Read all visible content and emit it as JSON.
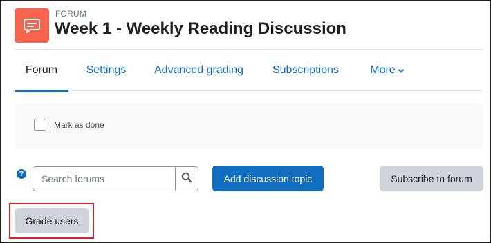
{
  "header": {
    "kicker": "FORUM",
    "title": "Week 1 - Weekly Reading Discussion",
    "icon": "forum-chat-icon",
    "icon_color": "#f7634d"
  },
  "tabs": [
    {
      "label": "Forum",
      "active": true
    },
    {
      "label": "Settings",
      "active": false
    },
    {
      "label": "Advanced grading",
      "active": false
    },
    {
      "label": "Subscriptions",
      "active": false
    },
    {
      "label": "More",
      "active": false
    }
  ],
  "completion": {
    "checkbox_label": "Mark as done",
    "checked": false
  },
  "actions": {
    "help_icon": "?",
    "search_placeholder": "Search forums",
    "search_value": "",
    "add_topic_label": "Add discussion topic",
    "subscribe_label": "Subscribe to forum",
    "grade_users_label": "Grade users"
  },
  "colors": {
    "link": "#0f6cbf",
    "primary_button": "#0f6cbf",
    "secondary_button": "#ced4da",
    "highlight": "#e02020"
  }
}
